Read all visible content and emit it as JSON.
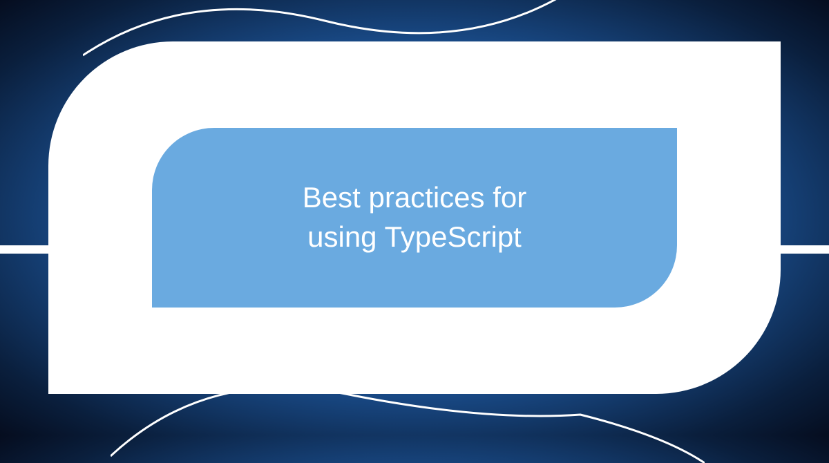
{
  "title_line1": "Best practices for",
  "title_line2": "using TypeScript"
}
